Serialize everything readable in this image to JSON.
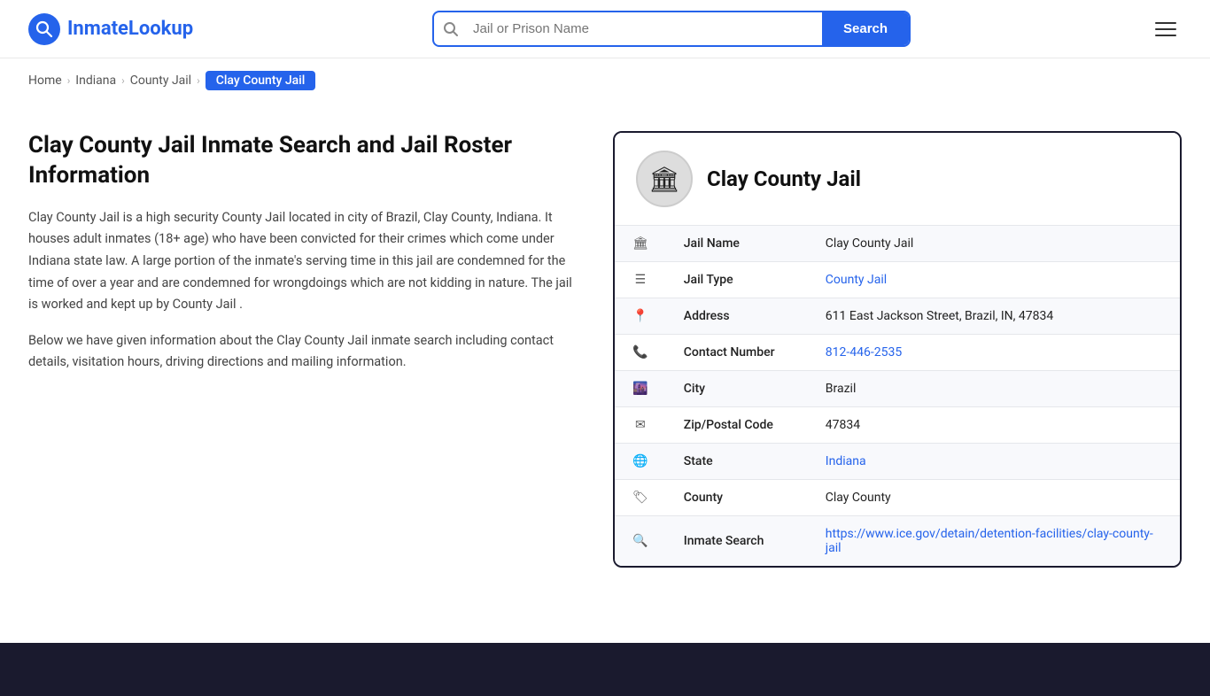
{
  "header": {
    "logo_prefix": "Inmate",
    "logo_suffix": "Lookup",
    "logo_icon_symbol": "Q",
    "search_placeholder": "Jail or Prison Name",
    "search_button_label": "Search",
    "menu_icon": "menu"
  },
  "breadcrumb": {
    "items": [
      {
        "label": "Home",
        "href": "#"
      },
      {
        "label": "Indiana",
        "href": "#"
      },
      {
        "label": "County Jail",
        "href": "#"
      },
      {
        "label": "Clay County Jail",
        "current": true
      }
    ],
    "separators": [
      "›",
      "›",
      "›"
    ]
  },
  "left": {
    "heading": "Clay County Jail Inmate Search and Jail Roster Information",
    "paragraph1": "Clay County Jail is a high security County Jail located in city of Brazil, Clay County, Indiana. It houses adult inmates (18+ age) who have been convicted for their crimes which come under Indiana state law. A large portion of the inmate's serving time in this jail are condemned for the time of over a year and are condemned for wrongdoings which are not kidding in nature. The jail is worked and kept up by County Jail .",
    "paragraph2": "Below we have given information about the Clay County Jail inmate search including contact details, visitation hours, driving directions and mailing information."
  },
  "card": {
    "jail_name": "Clay County Jail",
    "avatar_icon": "🏛",
    "rows": [
      {
        "icon": "🏛",
        "label": "Jail Name",
        "value": "Clay County Jail",
        "link": null
      },
      {
        "icon": "☰",
        "label": "Jail Type",
        "value": "County Jail",
        "link": "#"
      },
      {
        "icon": "📍",
        "label": "Address",
        "value": "611 East Jackson Street, Brazil, IN, 47834",
        "link": null
      },
      {
        "icon": "📞",
        "label": "Contact Number",
        "value": "812-446-2535",
        "link": "tel:812-446-2535"
      },
      {
        "icon": "🌆",
        "label": "City",
        "value": "Brazil",
        "link": null
      },
      {
        "icon": "✉",
        "label": "Zip/Postal Code",
        "value": "47834",
        "link": null
      },
      {
        "icon": "🌐",
        "label": "State",
        "value": "Indiana",
        "link": "#"
      },
      {
        "icon": "🏷",
        "label": "County",
        "value": "Clay County",
        "link": null
      },
      {
        "icon": "🔍",
        "label": "Inmate Search",
        "value": "https://www.ice.gov/detain/detention-facilities/clay-county-jail",
        "link": "https://www.ice.gov/detain/detention-facilities/clay-county-jail"
      }
    ]
  }
}
